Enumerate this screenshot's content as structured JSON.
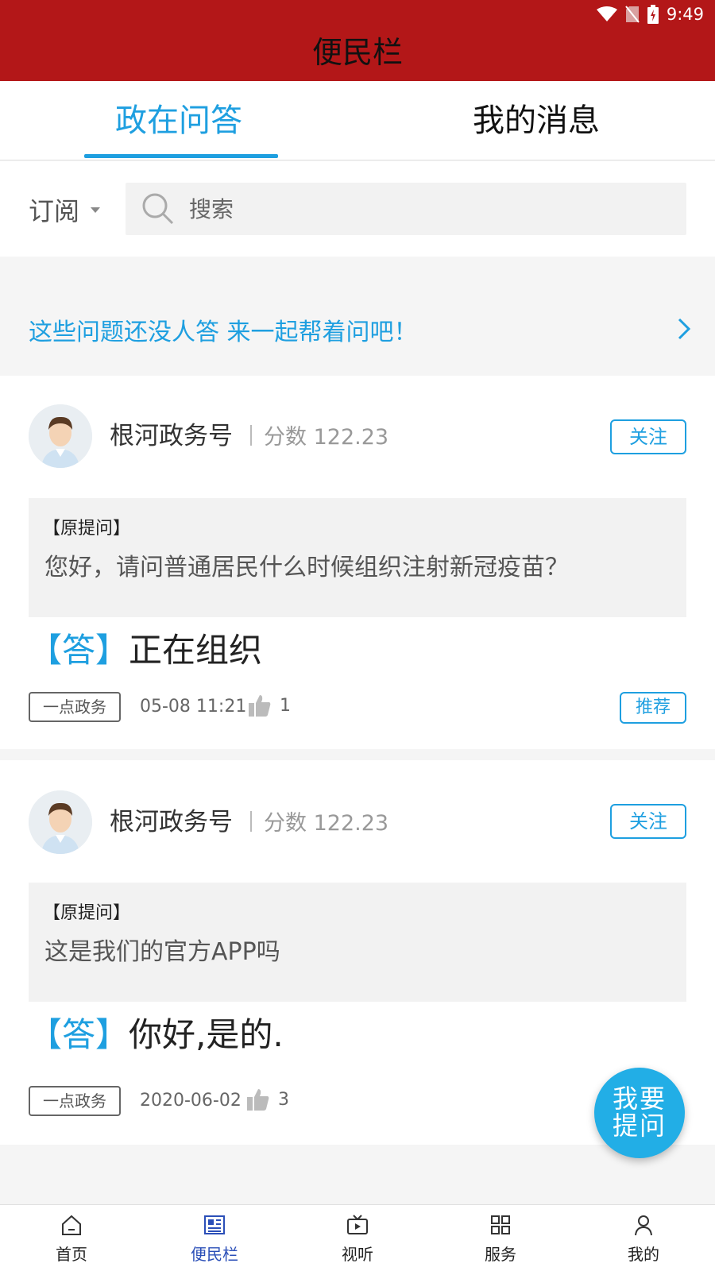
{
  "status_bar": {
    "time": "9:49"
  },
  "header": {
    "title": "便民栏"
  },
  "tabs": [
    {
      "label": "政在问答",
      "active": true
    },
    {
      "label": "我的消息",
      "active": false
    }
  ],
  "filter": {
    "label": "订阅"
  },
  "search": {
    "placeholder": "搜索"
  },
  "banner": {
    "text": "这些问题还没人答 来一起帮着问吧！"
  },
  "cards": [
    {
      "user": "根河政务号",
      "score": "分数 122.23",
      "follow_label": "关注",
      "question_tag": "【原提问】",
      "question": "您好，请问普通居民什么时候组织注射新冠疫苗？",
      "answer_tag": "【答】",
      "answer": "正在组织",
      "source": "一点政务",
      "date": "05-08 11:21",
      "likes": "1",
      "recommend_label": "推荐"
    },
    {
      "user": "根河政务号",
      "score": "分数 122.23",
      "follow_label": "关注",
      "question_tag": "【原提问】",
      "question": "这是我们的官方APP吗",
      "answer_tag": "【答】",
      "answer": "你好,是的.",
      "source": "一点政务",
      "date": "2020-06-02",
      "likes": "3"
    }
  ],
  "fab": {
    "line1": "我要",
    "line2": "提问"
  },
  "bottom_nav": [
    {
      "label": "首页",
      "icon": "home-icon",
      "active": false
    },
    {
      "label": "便民栏",
      "icon": "newspaper-icon",
      "active": true
    },
    {
      "label": "视听",
      "icon": "tv-icon",
      "active": false
    },
    {
      "label": "服务",
      "icon": "grid-icon",
      "active": false
    },
    {
      "label": "我的",
      "icon": "user-icon",
      "active": false
    }
  ],
  "colors": {
    "header_red": "#b31718",
    "accent_blue": "#1e9fe0",
    "nav_active": "#2b4fb8"
  }
}
